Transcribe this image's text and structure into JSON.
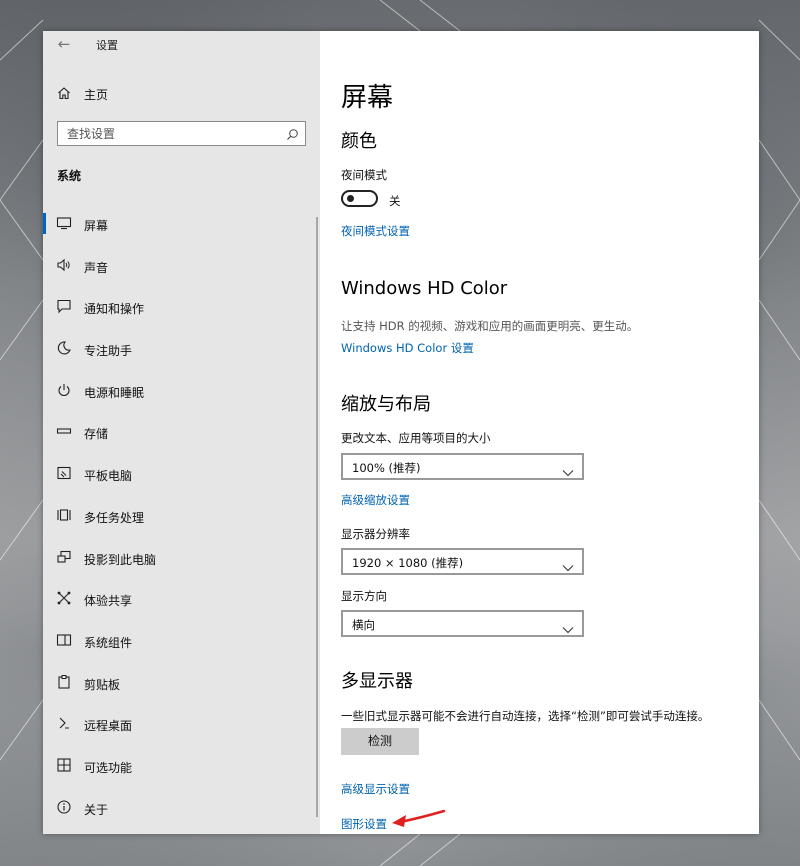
{
  "window": {
    "title": "设置"
  },
  "sidebar": {
    "home": {
      "label": "主页",
      "icon": "home-icon"
    },
    "search": {
      "placeholder": "查找设置"
    },
    "section": "系统",
    "items": [
      {
        "label": "屏幕",
        "icon": "monitor-icon",
        "active": true
      },
      {
        "label": "声音",
        "icon": "speaker-icon"
      },
      {
        "label": "通知和操作",
        "icon": "notification-icon"
      },
      {
        "label": "专注助手",
        "icon": "moon-icon"
      },
      {
        "label": "电源和睡眠",
        "icon": "power-icon"
      },
      {
        "label": "存储",
        "icon": "storage-icon"
      },
      {
        "label": "平板电脑",
        "icon": "tablet-icon"
      },
      {
        "label": "多任务处理",
        "icon": "multitask-icon"
      },
      {
        "label": "投影到此电脑",
        "icon": "project-icon"
      },
      {
        "label": "体验共享",
        "icon": "share-icon"
      },
      {
        "label": "系统组件",
        "icon": "components-icon"
      },
      {
        "label": "剪贴板",
        "icon": "clipboard-icon"
      },
      {
        "label": "远程桌面",
        "icon": "remote-icon"
      },
      {
        "label": "可选功能",
        "icon": "features-icon"
      },
      {
        "label": "关于",
        "icon": "info-icon"
      }
    ]
  },
  "main": {
    "title": "屏幕",
    "color": {
      "heading": "颜色",
      "night_label": "夜间模式",
      "night_state": "关",
      "night_link": "夜间模式设置"
    },
    "hdr": {
      "heading": "Windows HD Color",
      "desc": "让支持 HDR 的视频、游戏和应用的画面更明亮、更生动。",
      "link": "Windows HD Color 设置"
    },
    "scale": {
      "heading": "缩放与布局",
      "size_label": "更改文本、应用等项目的大小",
      "size_value": "100% (推荐)",
      "advanced_link": "高级缩放设置",
      "res_label": "显示器分辨率",
      "res_value": "1920 × 1080 (推荐)",
      "orient_label": "显示方向",
      "orient_value": "横向"
    },
    "multi": {
      "heading": "多显示器",
      "desc": "一些旧式显示器可能不会进行自动连接，选择“检测”即可尝试手动连接。",
      "detect": "检测",
      "advanced_link": "高级显示设置",
      "graphics_link": "图形设置"
    }
  },
  "colors": {
    "accent": "#0067c0",
    "link": "#0063b1",
    "annotation_arrow": "#e02020"
  }
}
